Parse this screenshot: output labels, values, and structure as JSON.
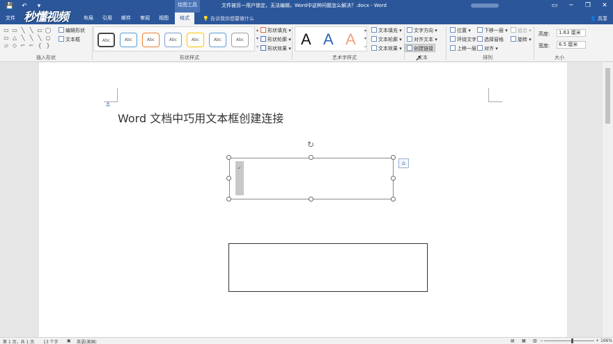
{
  "titlebar": {
    "quick_access": [
      "💾",
      "↶",
      "▾"
    ],
    "context_tab_title": "绘图工具",
    "document_title": "文件被另一用户锁定，无法编辑，Word中这种问题怎么解决？.docx - Word",
    "watermark": "秒懂视频",
    "window_controls": [
      "▭",
      "─",
      "❐",
      "✕"
    ]
  },
  "tabs": {
    "file": "文件",
    "layout_partial": "布局",
    "references": "引用",
    "mailings": "邮件",
    "review": "审阅",
    "view": "视图",
    "format": "格式",
    "tell_me": "告诉我你想要做什么",
    "share": "共享"
  },
  "ribbon": {
    "insert_shapes": {
      "label": "插入形状",
      "edit_shape": "编辑形状",
      "text_box": "文本框",
      "shape_glyphs": [
        "▭",
        "▭",
        "╲",
        "╲",
        "▭",
        "◯",
        "▭",
        "△",
        "╲",
        "╲",
        "╲",
        "○",
        "▱",
        "◇",
        "⌐",
        "⌐",
        "{",
        "}"
      ]
    },
    "shape_styles": {
      "label": "形状样式",
      "style_sample": "Abc",
      "style_colors": [
        "#444444",
        "#5b9bd5",
        "#ed7d31",
        "#7b9cc9",
        "#ffc000",
        "#5b9bd5",
        "#9e9e9e"
      ],
      "fill": "形状填充",
      "outline": "形状轮廓",
      "effects": "形状效果"
    },
    "wordart": {
      "label": "艺术字样式",
      "samples": [
        "A",
        "A",
        "A"
      ],
      "sample_colors": [
        "#111111",
        "#2e63b8",
        "#f2a17a"
      ],
      "text_fill": "文本填充",
      "text_outline": "文本轮廓",
      "text_effects": "文本效果"
    },
    "text": {
      "label": "文本",
      "direction": "文字方向",
      "align": "对齐文本",
      "create_link": "创建链接"
    },
    "arrange": {
      "label": "排列",
      "position": "位置",
      "wrap_text": "环绕文字",
      "bring_forward": "上移一层",
      "send_backward": "下移一层",
      "selection_pane": "选择窗格",
      "align": "对齐",
      "group": "组合",
      "rotate": "旋转"
    },
    "size": {
      "label": "大小",
      "height_label": "高度:",
      "height_value": "1.63 厘米",
      "width_label": "宽度:",
      "width_value": "6.5 厘米"
    }
  },
  "document": {
    "heading": "Word 文档中巧用文本框创建连接",
    "anchor_icon": "⚓",
    "rotate_icon": "↻",
    "layout_options_icon": "⌂",
    "textbox1_marker": "↙"
  },
  "statusbar": {
    "page": "第 1 页，共 1 页",
    "words": "13 个字",
    "language": "英语(美国)",
    "zoom": "166%"
  }
}
